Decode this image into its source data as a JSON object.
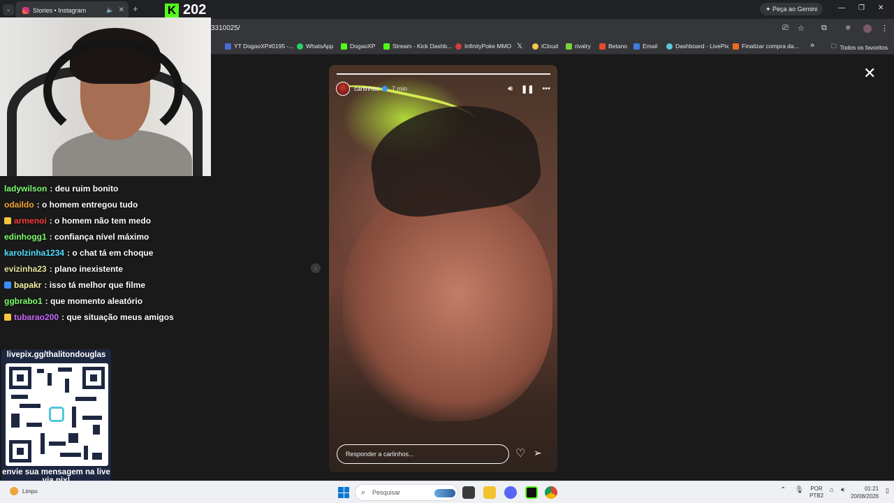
{
  "browser": {
    "tab_title": "Stories • Instagram",
    "url_fragment": "3310025/",
    "gemini_label": "Peça ao Gemini",
    "bookmarks": [
      {
        "label": "YT DogaoXP#0195 -...",
        "color": "#4a6bd8"
      },
      {
        "label": "WhatsApp",
        "color": "#25d366"
      },
      {
        "label": "DogaoXP",
        "color": "#53fc18"
      },
      {
        "label": "Stream - Kick Dashb...",
        "color": "#53fc18"
      },
      {
        "label": "InfinityPoke MMO",
        "color": "#d43c3c"
      },
      {
        "label": "",
        "color": "#e8eaed"
      },
      {
        "label": "iCloud",
        "color": "#f2c94c"
      },
      {
        "label": "rivalry",
        "color": "#7bd13a"
      },
      {
        "label": "Betano",
        "color": "#e84b2b"
      },
      {
        "label": "Email",
        "color": "#3d7ee0"
      },
      {
        "label": "Dashboard - LivePix",
        "color": "#5bc8d8"
      },
      {
        "label": "Finalizar compra da...",
        "color": "#f06a1d"
      }
    ],
    "all_bookmarks": "Todos os favoritos"
  },
  "kick": {
    "viewers": "202"
  },
  "chat": [
    {
      "user": "ladywilson",
      "text": ": deu ruim bonito",
      "color": "#7dff6e",
      "badge": ""
    },
    {
      "user": "odaildo",
      "text": ": o homem entregou tudo",
      "color": "#f6a636",
      "badge": ""
    },
    {
      "user": "armenoi",
      "text": ": o homem não tem medo",
      "color": "#ff3b3b",
      "badge": "#f5c542"
    },
    {
      "user": "edinhogg1",
      "text": ": confiança nível máximo",
      "color": "#7dff6e",
      "badge": ""
    },
    {
      "user": "karolzinha1234",
      "text": ": o chat tá em choque",
      "color": "#4fe0ff",
      "badge": ""
    },
    {
      "user": "evizinha23",
      "text": ": plano inexistente",
      "color": "#e6e59c",
      "badge": ""
    },
    {
      "user": "bapakr",
      "text": ": isso tá melhor que filme",
      "color": "#f5f0a0",
      "badge": "#3f8cff"
    },
    {
      "user": "ggbrabo1",
      "text": ": que momento aleatório",
      "color": "#7dff6e",
      "badge": ""
    },
    {
      "user": "tubarao200",
      "text": ": que situação meus amigos",
      "color": "#c86bff",
      "badge": "#f5c542"
    }
  ],
  "livepix": {
    "top": "livepix.gg/thalitondouglas",
    "bottom": "envie sua mensagem na live via pix!"
  },
  "story": {
    "username": "carlinhos",
    "time": "7 min",
    "reply_placeholder": "Responder a carlinhos..."
  },
  "taskbar": {
    "weather": "Limpo",
    "search": "Pesquisar",
    "lang1": "POR",
    "lang2": "PTB2",
    "time": "01:21",
    "date": "20/08/2026"
  }
}
